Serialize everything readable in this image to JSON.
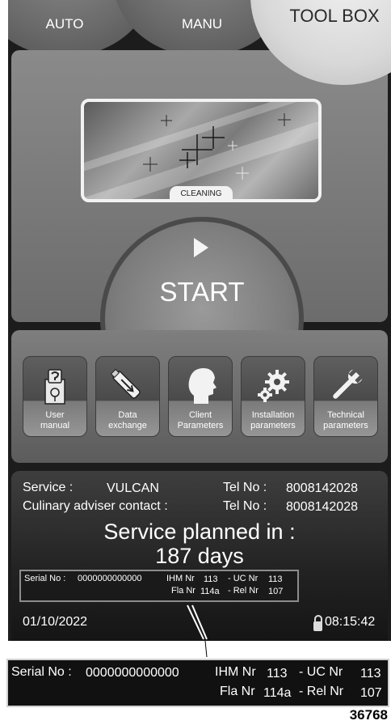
{
  "tabs": {
    "auto": "AUTO",
    "manu": "MANU",
    "toolbox": "TOOL BOX"
  },
  "program": {
    "label": "CLEANING"
  },
  "start": {
    "label": "START"
  },
  "tools": [
    {
      "line1": "User",
      "line2": "manual",
      "icon": "user-manual-icon"
    },
    {
      "line1": "Data",
      "line2": "exchange",
      "icon": "usb-stick-icon"
    },
    {
      "line1": "Client",
      "line2": "Parameters",
      "icon": "head-profile-icon"
    },
    {
      "line1": "Installation",
      "line2": "parameters",
      "icon": "gears-icon"
    },
    {
      "line1": "Technical",
      "line2": "parameters",
      "icon": "wrench-icon"
    }
  ],
  "service": {
    "service_label": "Service :",
    "service_value": "VULCAN",
    "tel_label": "Tel No :",
    "tel_value": "8008142028",
    "adviser_label": "Culinary adviser contact :",
    "adviser_tel_label": "Tel No :",
    "adviser_tel_value": "8008142028",
    "planned_label": "Service planned in :",
    "planned_value": "187 days"
  },
  "serial": {
    "serial_label": "Serial No :",
    "serial_value": "0000000000000",
    "ihm_label": "IHM Nr",
    "ihm_value": "113",
    "uc_label": "- UC Nr",
    "uc_value": "113",
    "fla_label": "Fla Nr",
    "fla_value": "114a",
    "rel_label": "- Rel Nr",
    "rel_value": "107"
  },
  "status": {
    "date": "01/10/2022",
    "time": "08:15:42"
  },
  "figure": {
    "code": "36768"
  },
  "colors": {
    "screen_bg": "#1c1c1c",
    "panel": "#7a7a7a",
    "text": "#ffffff"
  }
}
